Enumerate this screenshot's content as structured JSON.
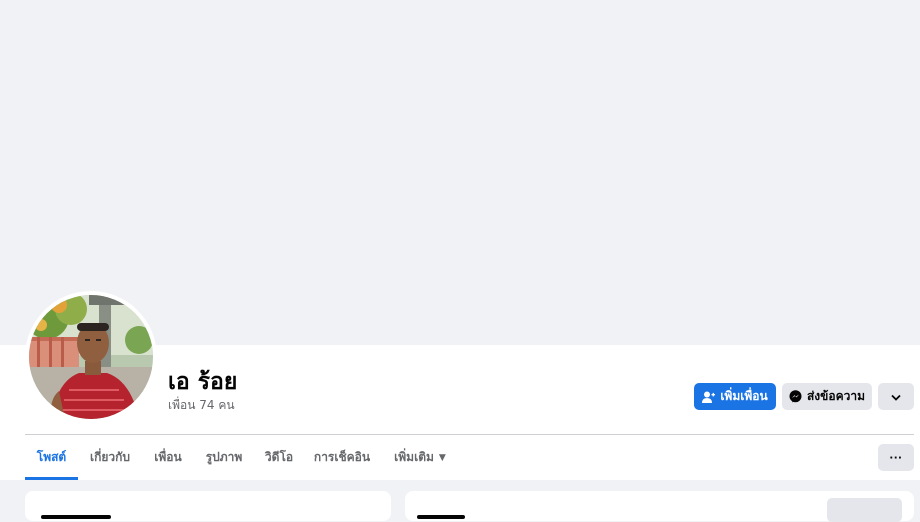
{
  "profile": {
    "name": "เอ ร้อย",
    "friends_count": "เพื่อน 74 คน"
  },
  "actions": {
    "add_friend_label": "เพิ่มเพื่อน",
    "add_friend_icon": "add-friend-icon",
    "message_label": "ส่งข้อความ",
    "message_icon": "messenger-icon",
    "more_icon": "chevron-down-icon"
  },
  "tabs": [
    {
      "label": "โพสต์",
      "active": true
    },
    {
      "label": "เกี่ยวกับ",
      "active": false
    },
    {
      "label": "เพื่อน",
      "active": false
    },
    {
      "label": "รูปภาพ",
      "active": false
    },
    {
      "label": "วิดีโอ",
      "active": false
    },
    {
      "label": "การเช็คอิน",
      "active": false
    },
    {
      "label": "เพิ่มเติม",
      "active": false,
      "dropdown": true
    }
  ],
  "tab_more_icon": "ellipsis-icon",
  "colors": {
    "accent": "#1b74e4",
    "background": "#f0f2f5",
    "button_secondary": "#e4e6eb",
    "text_primary": "#050505",
    "text_secondary": "#65676b"
  }
}
